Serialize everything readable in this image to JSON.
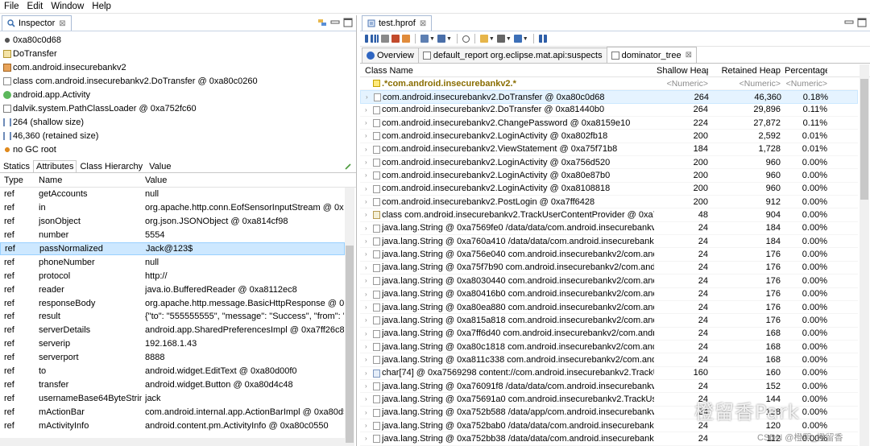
{
  "menu": [
    "File",
    "Edit",
    "Window",
    "Help"
  ],
  "inspector": {
    "tab_label": "Inspector",
    "close_glyph": "⊠",
    "info": [
      {
        "icon": "object-address-icon",
        "text": "0xa80c0d68"
      },
      {
        "icon": "class-icon",
        "text": "DoTransfer"
      },
      {
        "icon": "package-icon",
        "text": "com.android.insecurebankv2"
      },
      {
        "icon": "class-file-icon",
        "text": "class com.android.insecurebankv2.DoTransfer @ 0xa80c0260"
      },
      {
        "icon": "superclass-icon",
        "text": "android.app.Activity"
      },
      {
        "icon": "classloader-icon",
        "text": "dalvik.system.PathClassLoader @ 0xa752fc60"
      },
      {
        "icon": "shallow-size-icon",
        "text": "264 (shallow size)"
      },
      {
        "icon": "retained-size-icon",
        "text": "46,360 (retained size)"
      },
      {
        "icon": "gc-root-icon",
        "text": "no GC root"
      }
    ],
    "subtabs": [
      "Statics",
      "Attributes",
      "Class Hierarchy",
      "Value"
    ],
    "active_subtab": "Attributes",
    "columns": [
      "Type",
      "Name",
      "Value"
    ],
    "rows": [
      {
        "type": "ref",
        "name": "getAccounts",
        "value": "null"
      },
      {
        "type": "ref",
        "name": "in",
        "value": "org.apache.http.conn.EofSensorInputStream @ 0xa81..."
      },
      {
        "type": "ref",
        "name": "jsonObject",
        "value": "org.json.JSONObject @ 0xa814cf98"
      },
      {
        "type": "ref",
        "name": "number",
        "value": "5554"
      },
      {
        "type": "ref",
        "name": "passNormalized",
        "value": "Jack@123$"
      },
      {
        "type": "ref",
        "name": "phoneNumber",
        "value": "null"
      },
      {
        "type": "ref",
        "name": "protocol",
        "value": "http://"
      },
      {
        "type": "ref",
        "name": "reader",
        "value": "java.io.BufferedReader @ 0xa8112ec8"
      },
      {
        "type": "ref",
        "name": "responseBody",
        "value": "org.apache.http.message.BasicHttpResponse @ 0xa81..."
      },
      {
        "type": "ref",
        "name": "result",
        "value": "{\"to\": \"555555555\", \"message\": \"Success\", \"from\": \"99..."
      },
      {
        "type": "ref",
        "name": "serverDetails",
        "value": "android.app.SharedPreferencesImpl @ 0xa7ff26c8"
      },
      {
        "type": "ref",
        "name": "serverip",
        "value": "192.168.1.43"
      },
      {
        "type": "ref",
        "name": "serverport",
        "value": "8888"
      },
      {
        "type": "ref",
        "name": "to",
        "value": "android.widget.EditText @ 0xa80d00f0"
      },
      {
        "type": "ref",
        "name": "transfer",
        "value": "android.widget.Button @ 0xa80d4c48"
      },
      {
        "type": "ref",
        "name": "usernameBase64ByteString",
        "value": "jack"
      },
      {
        "type": "ref",
        "name": "mActionBar",
        "value": "com.android.internal.app.ActionBarImpl @ 0xa80d528..."
      },
      {
        "type": "ref",
        "name": "mActivityInfo",
        "value": "android.content.pm.ActivityInfo @ 0xa80c0550"
      }
    ],
    "selected_row": 4
  },
  "editor": {
    "file_tab": "test.hprof",
    "tabs": [
      {
        "label": "Overview",
        "icon": "info-icon"
      },
      {
        "label": "default_report  org.eclipse.mat.api:suspects",
        "icon": "report-icon"
      },
      {
        "label": "dominator_tree",
        "icon": "dominator-tree-icon",
        "closable": true
      }
    ],
    "active_tab": 2,
    "columns": [
      "Class Name",
      "Shallow Heap",
      "Retained Heap",
      "Percentage"
    ],
    "filter_row": {
      "class": ".*com.android.insecurebankv2.*",
      "shallow": "<Numeric>",
      "retained": "<Numeric>",
      "pct": "<Numeric>"
    },
    "rows": [
      {
        "name": "com.android.insecurebankv2.DoTransfer @ 0xa80c0d68",
        "shallow": "264",
        "retained": "46,360",
        "pct": "0.18%",
        "kind": "obj"
      },
      {
        "name": "com.android.insecurebankv2.DoTransfer @ 0xa81440b0",
        "shallow": "264",
        "retained": "29,896",
        "pct": "0.11%",
        "kind": "obj"
      },
      {
        "name": "com.android.insecurebankv2.ChangePassword @ 0xa8159e10",
        "shallow": "224",
        "retained": "27,872",
        "pct": "0.11%",
        "kind": "obj"
      },
      {
        "name": "com.android.insecurebankv2.LoginActivity @ 0xa802fb18",
        "shallow": "200",
        "retained": "2,592",
        "pct": "0.01%",
        "kind": "obj"
      },
      {
        "name": "com.android.insecurebankv2.ViewStatement @ 0xa75f71b8",
        "shallow": "184",
        "retained": "1,728",
        "pct": "0.01%",
        "kind": "obj"
      },
      {
        "name": "com.android.insecurebankv2.LoginActivity @ 0xa756d520",
        "shallow": "200",
        "retained": "960",
        "pct": "0.00%",
        "kind": "obj"
      },
      {
        "name": "com.android.insecurebankv2.LoginActivity @ 0xa80e87b0",
        "shallow": "200",
        "retained": "960",
        "pct": "0.00%",
        "kind": "obj"
      },
      {
        "name": "com.android.insecurebankv2.LoginActivity @ 0xa8108818",
        "shallow": "200",
        "retained": "960",
        "pct": "0.00%",
        "kind": "obj"
      },
      {
        "name": "com.android.insecurebankv2.PostLogin @ 0xa7ff6428",
        "shallow": "200",
        "retained": "912",
        "pct": "0.00%",
        "kind": "obj"
      },
      {
        "name": "class com.android.insecurebankv2.TrackUserContentProvider @ 0xa7568d",
        "shallow": "48",
        "retained": "904",
        "pct": "0.00%",
        "kind": "cls"
      },
      {
        "name": "java.lang.String @ 0xa7569fe0  /data/data/com.android.insecurebankv2/c",
        "shallow": "24",
        "retained": "184",
        "pct": "0.00%",
        "kind": "obj"
      },
      {
        "name": "java.lang.String @ 0xa760a410  /data/data/com.android.insecurebankv2/c",
        "shallow": "24",
        "retained": "184",
        "pct": "0.00%",
        "kind": "obj"
      },
      {
        "name": "java.lang.String @ 0xa756e040  com.android.insecurebankv2/com.androi",
        "shallow": "24",
        "retained": "176",
        "pct": "0.00%",
        "kind": "obj"
      },
      {
        "name": "java.lang.String @ 0xa75f7b90  com.android.insecurebankv2/com.androi",
        "shallow": "24",
        "retained": "176",
        "pct": "0.00%",
        "kind": "obj"
      },
      {
        "name": "java.lang.String @ 0xa8030440  com.android.insecurebankv2/com.androi",
        "shallow": "24",
        "retained": "176",
        "pct": "0.00%",
        "kind": "obj"
      },
      {
        "name": "java.lang.String @ 0xa80416b0  com.android.insecurebankv2/com.androi",
        "shallow": "24",
        "retained": "176",
        "pct": "0.00%",
        "kind": "obj"
      },
      {
        "name": "java.lang.String @ 0xa80ea880  com.android.insecurebankv2/com.androi",
        "shallow": "24",
        "retained": "176",
        "pct": "0.00%",
        "kind": "obj"
      },
      {
        "name": "java.lang.String @ 0xa815a818  com.android.insecurebankv2/com.androi",
        "shallow": "24",
        "retained": "176",
        "pct": "0.00%",
        "kind": "obj"
      },
      {
        "name": "java.lang.String @ 0xa7ff6d40  com.android.insecurebankv2/com.androi",
        "shallow": "24",
        "retained": "168",
        "pct": "0.00%",
        "kind": "obj"
      },
      {
        "name": "java.lang.String @ 0xa80c1818  com.android.insecurebankv2/com.androi",
        "shallow": "24",
        "retained": "168",
        "pct": "0.00%",
        "kind": "obj"
      },
      {
        "name": "java.lang.String @ 0xa811c338  com.android.insecurebankv2/com.androi",
        "shallow": "24",
        "retained": "168",
        "pct": "0.00%",
        "kind": "obj"
      },
      {
        "name": "char[74] @ 0xa7569298  content://com.android.insecurebankv2.TrackUse",
        "shallow": "160",
        "retained": "160",
        "pct": "0.00%",
        "kind": "bin"
      },
      {
        "name": "java.lang.String @ 0xa76091f8  /data/data/com.android.insecurebankv2/c",
        "shallow": "24",
        "retained": "152",
        "pct": "0.00%",
        "kind": "obj"
      },
      {
        "name": "java.lang.String @ 0xa75691a0  com.android.insecurebankv2.TrackUserCo",
        "shallow": "24",
        "retained": "144",
        "pct": "0.00%",
        "kind": "obj"
      },
      {
        "name": "java.lang.String @ 0xa752b588  /data/app/com.android.insecurebankv2-1",
        "shallow": "24",
        "retained": "128",
        "pct": "0.00%",
        "kind": "obj"
      },
      {
        "name": "java.lang.String @ 0xa752bab0  /data/data/com.android.insecurebankv2/",
        "shallow": "24",
        "retained": "120",
        "pct": "0.00%",
        "kind": "obj"
      },
      {
        "name": "java.lang.String @ 0xa752bb38  /data/data/com.android.insecurebankv2",
        "shallow": "24",
        "retained": "112",
        "pct": "0.00%",
        "kind": "obj"
      }
    ],
    "selected_row": 0
  },
  "watermark": {
    "main": "橙留香Park",
    "sub": "CSDN @橙熙_橙留香"
  },
  "colors": {
    "selection": "#cde8ff",
    "tab_border": "#a9bbd5",
    "regex": "#8a6d00"
  }
}
